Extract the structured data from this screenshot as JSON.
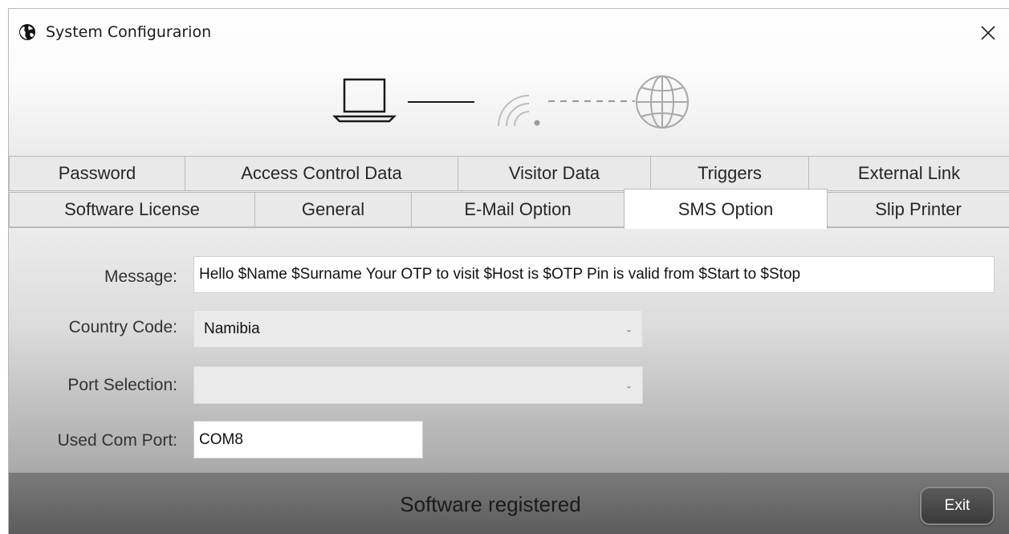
{
  "window": {
    "title": "System Configurarion",
    "close_label": "✕",
    "app_icon": "globe-icon"
  },
  "banner": {
    "icons": [
      "laptop-icon",
      "wifi-signal-icon",
      "globe-icon"
    ]
  },
  "tabs": {
    "row1": [
      {
        "label": "Password"
      },
      {
        "label": "Access Control Data"
      },
      {
        "label": "Visitor Data"
      },
      {
        "label": "Triggers"
      },
      {
        "label": "External Link"
      }
    ],
    "row2": [
      {
        "label": "Software License"
      },
      {
        "label": "General"
      },
      {
        "label": "E-Mail Option"
      },
      {
        "label": "SMS Option"
      },
      {
        "label": "Slip Printer"
      }
    ],
    "selected": "SMS Option"
  },
  "form": {
    "message_label": "Message:",
    "message_value": "Hello $Name $Surname Your OTP to visit $Host is $OTP Pin is valid from $Start to $Stop",
    "country_code_label": "Country Code:",
    "country_code_value": "Namibia",
    "port_selection_label": "Port Selection:",
    "port_selection_value": "",
    "used_com_port_label": "Used Com Port:",
    "used_com_port_value": "COM8",
    "chevron": "⌄"
  },
  "footer": {
    "status": "Software registered",
    "exit_label": "Exit"
  },
  "colors": {
    "selected_tab": "#ffffff",
    "tab_background": "#e9e9e9",
    "footer_background": "#666666",
    "exit_button": "#4a4a4a"
  }
}
